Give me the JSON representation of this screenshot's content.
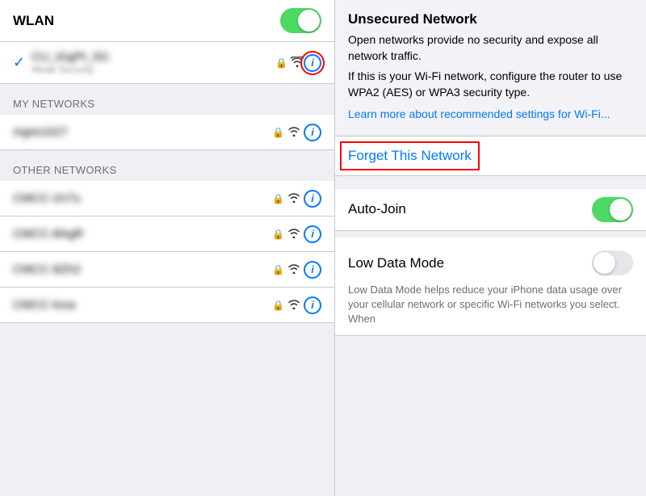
{
  "left": {
    "wlan_label": "WLAN",
    "connected_network": {
      "name": "CU_iGgPt_5G",
      "sub": "Weak Security"
    },
    "my_networks_header": "MY NETWORKS",
    "my_networks": [
      {
        "name": "mgre1027"
      }
    ],
    "other_networks_header": "OTHER NETWORKS",
    "other_networks": [
      {
        "name": "CMCC-2n7u"
      },
      {
        "name": "CMCC-8AgR"
      },
      {
        "name": "CMCC-8Zh2"
      },
      {
        "name": "CMCC-lova"
      }
    ]
  },
  "right": {
    "unsecured_title": "Unsecured Network",
    "unsecured_desc1": "Open networks provide no security and expose all network traffic.",
    "unsecured_desc2": "If this is your Wi-Fi network, configure the router to use WPA2 (AES) or WPA3 security type.",
    "learn_more": "Learn more about recommended settings for Wi-Fi...",
    "forget_label": "Forget This Network",
    "autojoin_label": "Auto-Join",
    "lowdata_label": "Low Data Mode",
    "lowdata_desc": "Low Data Mode helps reduce your iPhone data usage over your cellular network or specific Wi-Fi networks you select. When"
  },
  "icons": {
    "info": "i",
    "lock": "🔒",
    "wifi": "📶",
    "check": "✓"
  }
}
